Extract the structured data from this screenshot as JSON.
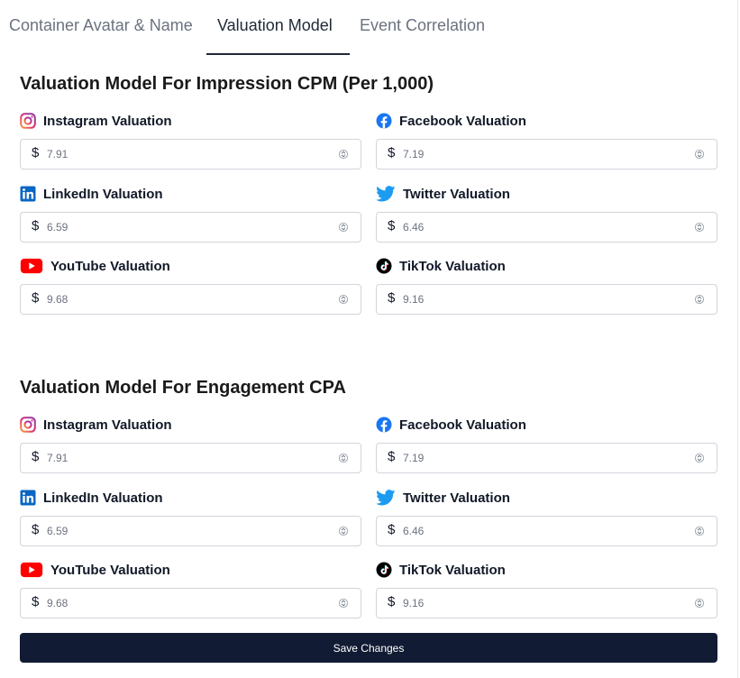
{
  "tabs": [
    {
      "label": "Container Avatar & Name",
      "active": false
    },
    {
      "label": "Valuation Model",
      "active": true
    },
    {
      "label": "Event Correlation",
      "active": false
    }
  ],
  "currency_symbol": "$",
  "sections": [
    {
      "title": "Valuation Model For Impression CPM (Per 1,000)",
      "fields": [
        {
          "platform": "instagram",
          "icon": "instagram-icon",
          "label": "Instagram Valuation",
          "value": "7.91"
        },
        {
          "platform": "facebook",
          "icon": "facebook-icon",
          "label": "Facebook Valuation",
          "value": "7.19"
        },
        {
          "platform": "linkedin",
          "icon": "linkedin-icon",
          "label": "LinkedIn Valuation",
          "value": "6.59"
        },
        {
          "platform": "twitter",
          "icon": "twitter-icon",
          "label": "Twitter Valuation",
          "value": "6.46"
        },
        {
          "platform": "youtube",
          "icon": "youtube-icon",
          "label": "YouTube Valuation",
          "value": "9.68"
        },
        {
          "platform": "tiktok",
          "icon": "tiktok-icon",
          "label": "TikTok Valuation",
          "value": "9.16"
        }
      ]
    },
    {
      "title": "Valuation Model For Engagement CPA",
      "fields": [
        {
          "platform": "instagram",
          "icon": "instagram-icon",
          "label": "Instagram Valuation",
          "value": "7.91"
        },
        {
          "platform": "facebook",
          "icon": "facebook-icon",
          "label": "Facebook Valuation",
          "value": "7.19"
        },
        {
          "platform": "linkedin",
          "icon": "linkedin-icon",
          "label": "LinkedIn Valuation",
          "value": "6.59"
        },
        {
          "platform": "twitter",
          "icon": "twitter-icon",
          "label": "Twitter Valuation",
          "value": "6.46"
        },
        {
          "platform": "youtube",
          "icon": "youtube-icon",
          "label": "YouTube Valuation",
          "value": "9.68"
        },
        {
          "platform": "tiktok",
          "icon": "tiktok-icon",
          "label": "TikTok Valuation",
          "value": "9.16"
        }
      ]
    }
  ],
  "save_button": {
    "label": "Save Changes"
  },
  "colors": {
    "button_bg": "#111b33",
    "tab_underline": "#1f2937",
    "facebook": "#1877f2",
    "linkedin": "#0a66c2",
    "twitter": "#1d9bf0",
    "youtube": "#ff0000",
    "tiktok": "#000000"
  }
}
